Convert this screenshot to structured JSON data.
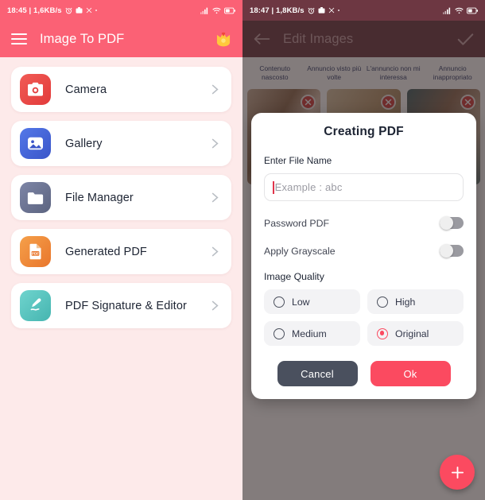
{
  "left_screen": {
    "status_bar": {
      "time_and_rate": "18:45 | 1,6KB/s",
      "icons_left": [
        "alarm-icon",
        "camera-icon",
        "x-icon",
        "dot-icon"
      ],
      "icons_right": [
        "signal-icon",
        "wifi-icon",
        "battery-icon"
      ]
    },
    "app_bar": {
      "menu_icon": "hamburger-menu-icon",
      "title": "Image To PDF",
      "premium_icon": "crown-premium-icon"
    },
    "menu_items": [
      {
        "label": "Camera",
        "icon": "camera-icon",
        "color": "#EF4444",
        "chevron": "chevron-right-icon"
      },
      {
        "label": "Gallery",
        "icon": "gallery-image-icon",
        "color": "#4465DD",
        "chevron": "chevron-right-icon"
      },
      {
        "label": "File Manager",
        "icon": "folder-icon",
        "color": "#6C7391",
        "chevron": "chevron-right-icon"
      },
      {
        "label": "Generated PDF",
        "icon": "pdf-file-icon",
        "color": "#F08A3C",
        "chevron": "chevron-right-icon"
      },
      {
        "label": "PDF Signature & Editor",
        "icon": "signature-pen-icon",
        "color": "#58C3BE",
        "chevron": "chevron-right-icon"
      }
    ]
  },
  "right_screen": {
    "status_bar": {
      "time_and_rate": "18:47 | 1,8KB/s",
      "icons_left": [
        "alarm-icon",
        "camera-icon",
        "x-icon",
        "dot-icon"
      ],
      "icons_right": [
        "signal-icon",
        "wifi-icon",
        "battery-icon"
      ]
    },
    "app_bar": {
      "back_icon": "arrow-left-icon",
      "title": "Edit Images",
      "confirm_icon": "check-icon"
    },
    "ad_feedback_options": [
      "Contenuto nascosto",
      "Annuncio visto più volte",
      "L'annuncio non mi interessa",
      "Annuncio inappropriato"
    ],
    "thumbnails": [
      {
        "name": "image-thumbnail-1",
        "remove_icon": "remove-x-icon"
      },
      {
        "name": "image-thumbnail-2",
        "remove_icon": "remove-x-icon"
      },
      {
        "name": "image-thumbnail-3",
        "remove_icon": "remove-x-icon"
      }
    ],
    "fab": {
      "icon": "plus-icon"
    },
    "dialog": {
      "title": "Creating PDF",
      "file_name_label": "Enter File Name",
      "file_name_value": "",
      "file_name_placeholder": "Example : abc",
      "password_toggle": {
        "label": "Password PDF",
        "state": "off"
      },
      "grayscale_toggle": {
        "label": "Apply Grayscale",
        "state": "off"
      },
      "image_quality_label": "Image Quality",
      "image_quality_options": [
        {
          "label": "Low",
          "selected": false
        },
        {
          "label": "High",
          "selected": false
        },
        {
          "label": "Medium",
          "selected": false
        },
        {
          "label": "Original",
          "selected": true
        }
      ],
      "cancel_label": "Cancel",
      "ok_label": "Ok"
    }
  },
  "colors": {
    "brand_pink": "#FB6175",
    "accent_red": "#FB4A60",
    "left_background": "#FDEAEA",
    "dark_slate": "#4A505E",
    "scrim": "rgba(48,36,36,.60)"
  }
}
